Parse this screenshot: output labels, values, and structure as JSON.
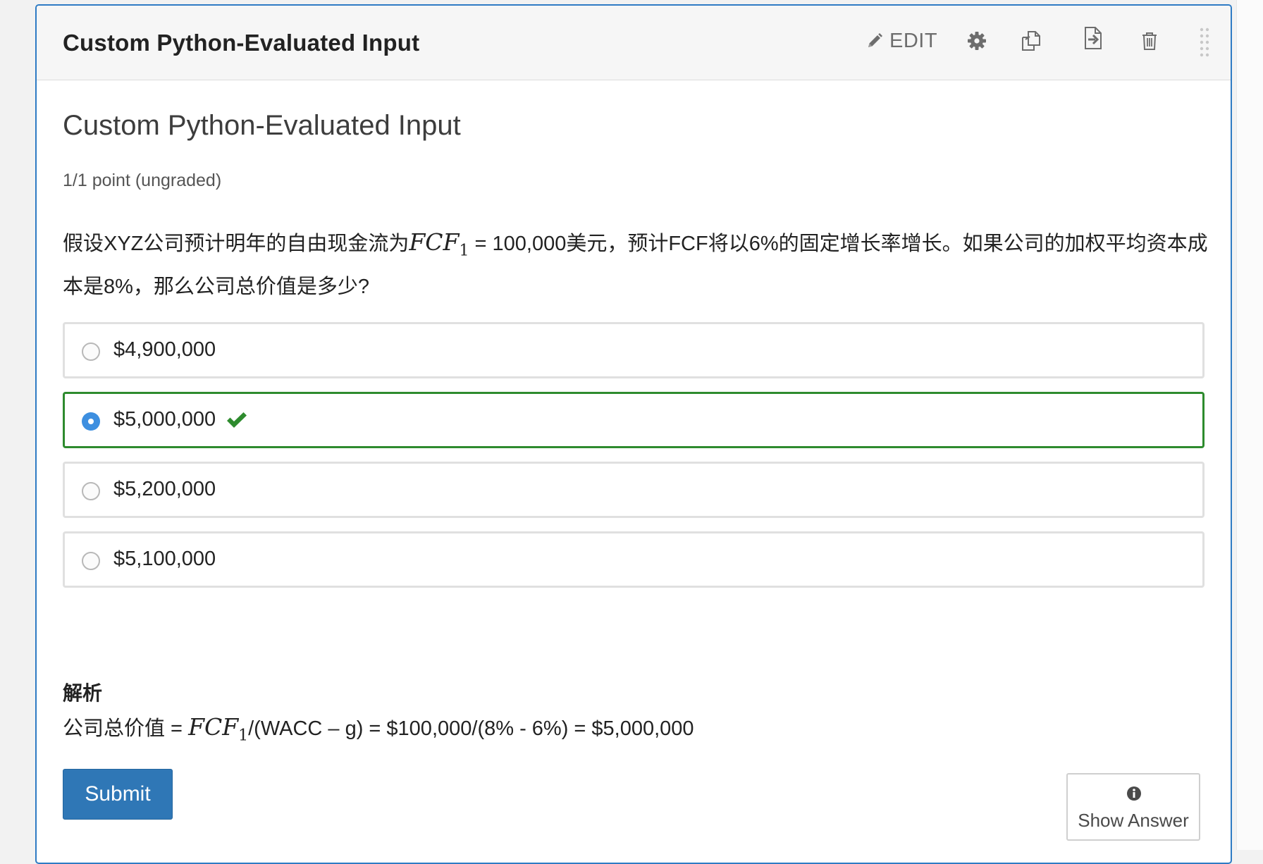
{
  "header": {
    "title": "Custom Python-Evaluated Input",
    "edit_label": "EDIT",
    "icons": [
      "pencil-icon",
      "gear-icon",
      "duplicate-icon",
      "move-icon",
      "trash-icon",
      "drag-handle-icon"
    ]
  },
  "problem": {
    "title": "Custom Python-Evaluated Input",
    "points": "1/1 point (ungraded)",
    "question_before": "假设XYZ公司预计明年的自由现金流为",
    "question_math": "FCF",
    "question_math_sub": "1",
    "question_after": " = 100,000美元，预计FCF将以6%的固定增长率增长。如果公司的加权平均资本成本是8%，那么公司总价值是多少?"
  },
  "choices": [
    {
      "label": "$4,900,000",
      "selected": false,
      "correct": false
    },
    {
      "label": "$5,000,000",
      "selected": true,
      "correct": true
    },
    {
      "label": "$5,200,000",
      "selected": false,
      "correct": false
    },
    {
      "label": "$5,100,000",
      "selected": false,
      "correct": false
    }
  ],
  "solution": {
    "heading": "解析",
    "text_before": "公司总价值 = ",
    "math": "FCF",
    "math_sub": "1",
    "text_after": "/(WACC – g) = $100,000/(8% - 6%) = $5,000,000"
  },
  "buttons": {
    "submit": "Submit",
    "show_answer": "Show Answer"
  },
  "colors": {
    "accent": "#2e7bc4",
    "submit_bg": "#2f77b6",
    "correct": "#2e8b2e",
    "radio_checked": "#3d8fe0"
  }
}
